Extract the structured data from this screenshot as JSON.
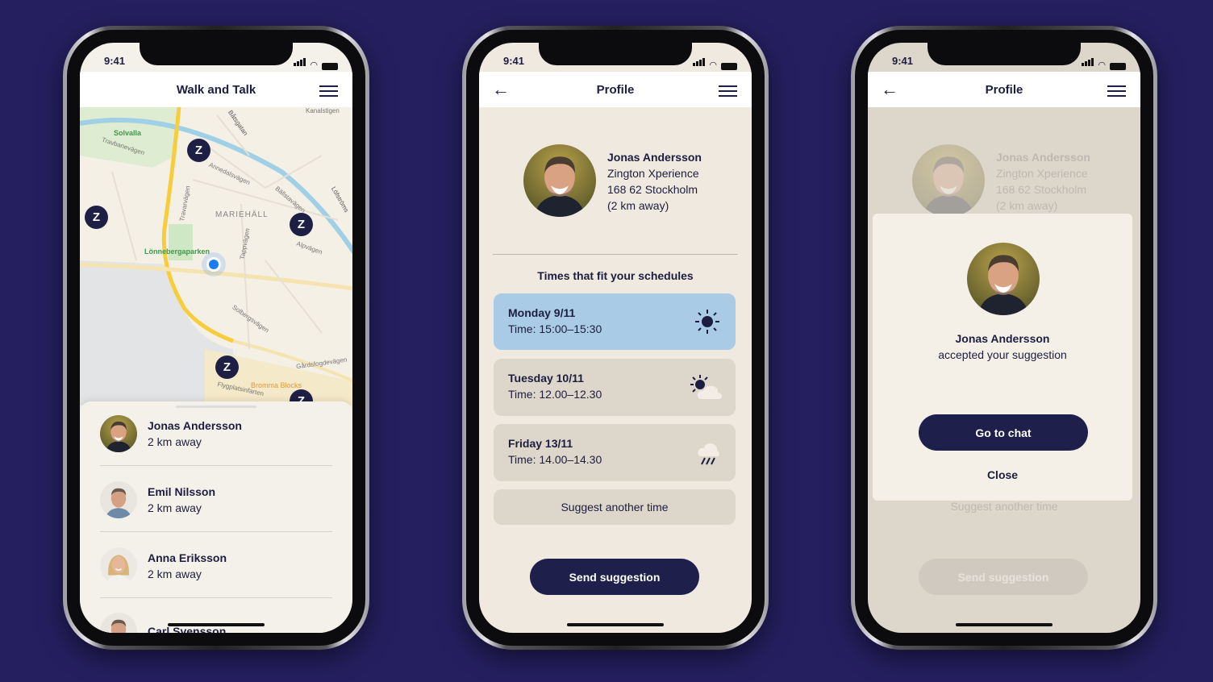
{
  "status": {
    "time": "9:41"
  },
  "screen1": {
    "title": "Walk and Talk",
    "map_labels": [
      "Solvalla",
      "Travbanevägen",
      "Annedalsvägen",
      "MARIEHÄLL",
      "Lönnebergaparken",
      "Tappvägen",
      "Travarvägen",
      "Alpvägen",
      "Solbergsvägen",
      "Gårdsfogdevägen",
      "Bromma Blocks",
      "Flygplatsinfarten",
      "Kanalstigen",
      "Båtsgatan",
      "Bällstavägen",
      "Löfströms"
    ],
    "pin_glyph": "Z",
    "people": [
      {
        "name": "Jonas Andersson",
        "distance": "2 km away"
      },
      {
        "name": "Emil Nilsson",
        "distance": "2 km away"
      },
      {
        "name": "Anna Eriksson",
        "distance": "2 km away"
      },
      {
        "name": "Carl Svensson",
        "distance": ""
      }
    ]
  },
  "screen2": {
    "title": "Profile",
    "profile": {
      "name": "Jonas Andersson",
      "company": "Zington Xperience",
      "address": "168 62 Stockholm",
      "distance": "(2 km away)"
    },
    "section_title": "Times that fit your schedules",
    "slots": [
      {
        "day": "Monday 9/11",
        "time": "Time: 15:00–15:30",
        "weather": "sun-icon",
        "selected": true
      },
      {
        "day": "Tuesday 10/11",
        "time": "Time: 12.00–12.30",
        "weather": "partly-cloudy-icon",
        "selected": false
      },
      {
        "day": "Friday 13/11",
        "time": "Time: 14.00–14.30",
        "weather": "rain-icon",
        "selected": false
      }
    ],
    "suggest_another": "Suggest another time",
    "send": "Send suggestion"
  },
  "screen3": {
    "title": "Profile",
    "modal": {
      "name": "Jonas Andersson",
      "message": "accepted your suggestion",
      "go_to_chat": "Go to chat",
      "close": "Close"
    }
  },
  "colors": {
    "background": "#251f5f",
    "navy": "#1e1f4b",
    "selected_slot": "#a9cbe6",
    "slot": "#ddd6ca",
    "screen": "#efe9df"
  }
}
